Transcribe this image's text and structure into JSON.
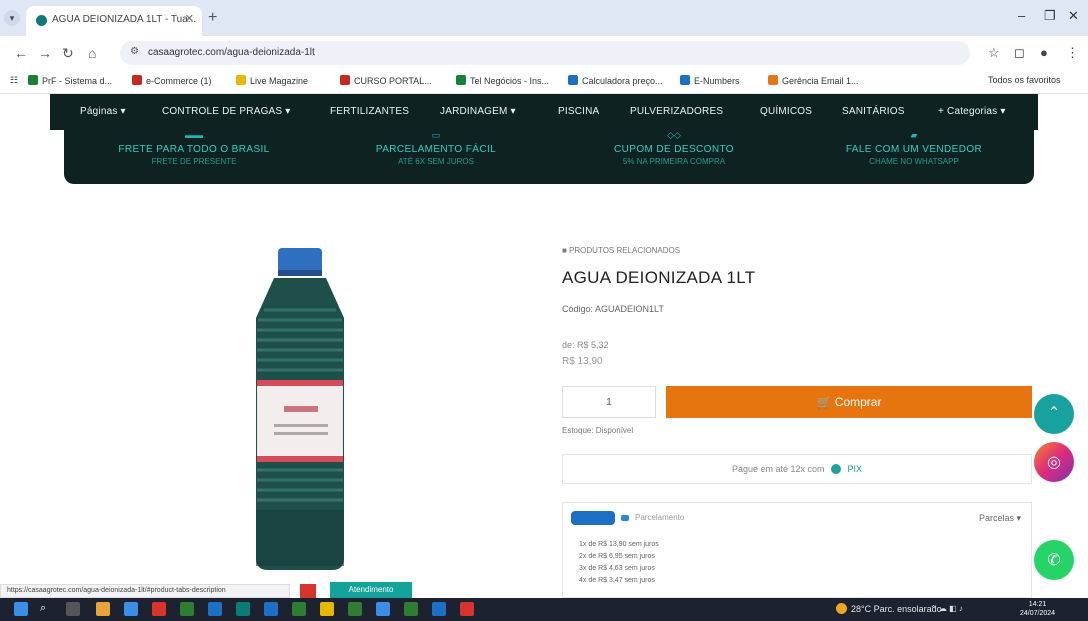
{
  "browser": {
    "tab_title": "AGUA DEIONIZADA 1LT - Tua...",
    "tab_close": "✕",
    "new_tab": "+",
    "url": "casaagrotec.com/agua-deionizada-1lt",
    "bookmarks": [
      {
        "label": "PrF - Sistema d...",
        "color": "#1a7f37"
      },
      {
        "label": "e-Commerce (1)",
        "color": "#c62828"
      },
      {
        "label": "Live Magazine",
        "color": "#e6b800"
      },
      {
        "label": "CURSO PORTAL...",
        "color": "#c62828"
      },
      {
        "label": "Tel Negócios - Ins...",
        "color": "#1a7f37"
      },
      {
        "label": "Calculadora preço...",
        "color": "#1b6fc4"
      },
      {
        "label": "E-Numbers",
        "color": "#1b6fc4"
      },
      {
        "label": "Gerência Email 1...",
        "color": "#e6750f"
      }
    ],
    "all_bookmarks": "Todos os favoritos"
  },
  "nav": {
    "items": [
      "Páginas ▾",
      "CONTROLE DE PRAGAS ▾",
      "FERTILIZANTES",
      "JARDINAGEM ▾",
      "PISCINA",
      "PULVERIZADORES",
      "QUÍMICOS",
      "SANITÁRIOS",
      "+ Categorias ▾"
    ]
  },
  "benefits": [
    {
      "title": "FRETE PARA TODO O BRASIL",
      "sub": "FRETE DE PRESENTE",
      "icon": "truck-icon"
    },
    {
      "title": "PARCELAMENTO FÁCIL",
      "sub": "ATÉ 6X SEM JUROS",
      "icon": "card-icon"
    },
    {
      "title": "CUPOM DE DESCONTO",
      "sub": "5% NA PRIMEIRA COMPRA",
      "icon": "ticket-icon"
    },
    {
      "title": "FALE COM UM VENDEDOR",
      "sub": "CHAME NO WHATSAPP",
      "icon": "chat-icon"
    }
  ],
  "product": {
    "breadcrumb": "■ PRODUTOS RELACIONADOS",
    "title": "AGUA DEIONIZADA 1LT",
    "code": "Código: AGUADEION1LT",
    "old_price": "de: R$ 5,32",
    "price": "R$ 13,90",
    "quantity": "1",
    "buy_label": "Comprar",
    "stock": "Estoque: Disponível",
    "pay_text": "Pague em até 12x com",
    "pay_brand": "PIX",
    "installments_title": "Parcelamento",
    "installments_toggle": "Parcelas ▾",
    "installments": [
      "1x de R$ 13,90 sem juros",
      "2x de R$ 6,95 sem juros",
      "3x de R$ 4,63 sem juros",
      "4x de R$ 3,47 sem juros"
    ]
  },
  "status_url": "https://casaagrotec.com/agua-deionizada-1lt/#product-tabs-description",
  "help_chip": "Atendimento",
  "taskbar": {
    "weather": "28°C Parc. ensolarado",
    "time": "14:21",
    "date": "24/07/2024"
  },
  "colors": {
    "nav_bg": "#0e2222",
    "accent_teal": "#2ed0c2",
    "buy_orange": "#e6750f",
    "instagram": "#e1306c",
    "whatsapp": "#25d366"
  }
}
